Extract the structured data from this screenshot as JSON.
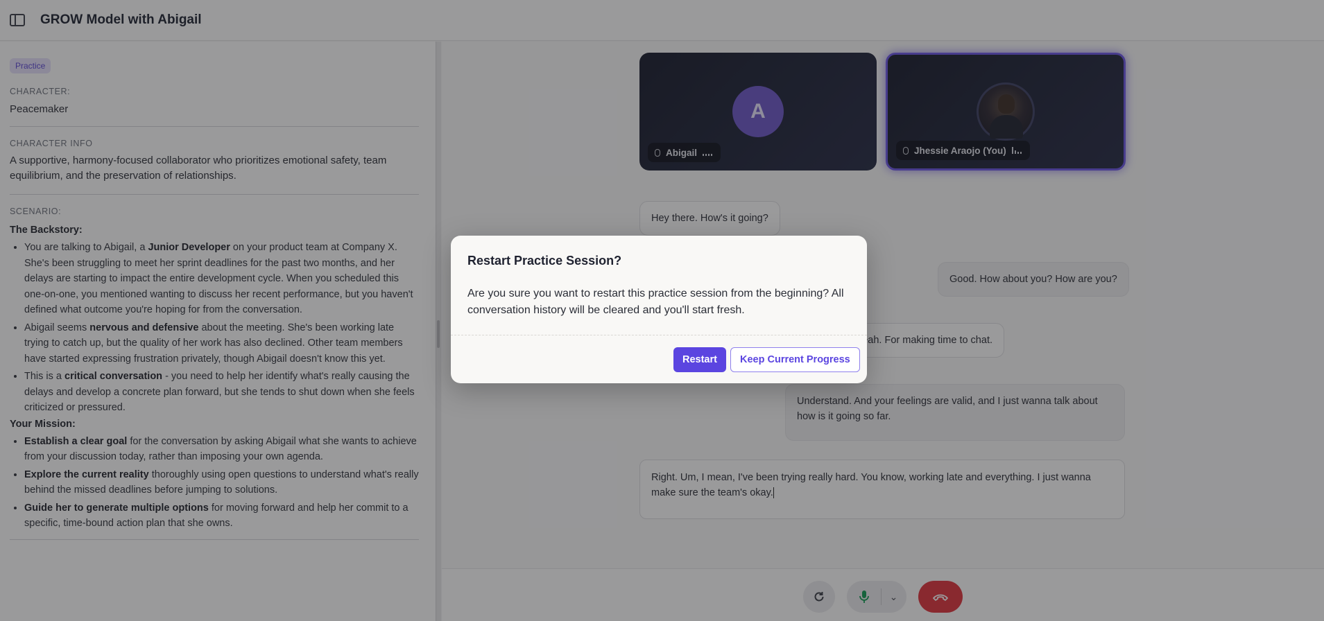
{
  "header": {
    "title": "GROW Model with Abigail",
    "toggle_icon": "sidebar-toggle-icon"
  },
  "left": {
    "badge": "Practice",
    "character_label": "CHARACTER:",
    "character_value": "Peacemaker",
    "info_label": "CHARACTER INFO",
    "info_value": "A supportive, harmony-focused collaborator who prioritizes emotional safety, team equilibrium, and the preservation of relationships.",
    "scenario_label": "SCENARIO:",
    "backstory_head": "The Backstory:",
    "backstory": [
      {
        "pre": "You are talking to Abigail, a ",
        "bold": "Junior Developer",
        "post": " on your product team at Company X. She's been struggling to meet her sprint deadlines for the past two months, and her delays are starting to impact the entire development cycle. When you scheduled this one-on-one, you mentioned wanting to discuss her recent performance, but you haven't defined what outcome you're hoping for from the conversation."
      },
      {
        "pre": "Abigail seems ",
        "bold": "nervous and defensive",
        "post": " about the meeting. She's been working late trying to catch up, but the quality of her work has also declined. Other team members have started expressing frustration privately, though Abigail doesn't know this yet."
      },
      {
        "pre": "This is a ",
        "bold": "critical conversation",
        "post": " - you need to help her identify what's really causing the delays and develop a concrete plan forward, but she tends to shut down when she feels criticized or pressured."
      }
    ],
    "mission_head": "Your Mission:",
    "mission": [
      {
        "pre": "",
        "bold": "Establish a clear goal",
        "post": " for the conversation by asking Abigail what she wants to achieve from your discussion today, rather than imposing your own agenda."
      },
      {
        "pre": "",
        "bold": "Explore the current reality",
        "post": " thoroughly using open questions to understand what's really behind the missed deadlines before jumping to solutions."
      },
      {
        "pre": "",
        "bold": "Guide her to generate multiple options",
        "post": " for moving forward and help her commit to a specific, time-bound action plan that she owns."
      }
    ]
  },
  "participants": {
    "ai": {
      "initial": "A",
      "name": "Abigail"
    },
    "user": {
      "name": "Jhessie Araojo (You)"
    }
  },
  "chat": {
    "m1": "Hey there. How's it going?",
    "m2": "Good. How about you? How are you?",
    "m3": "eah. For making time to chat.",
    "m4": " Understand. And your feelings are valid, and I just wanna talk about how is it going so far.",
    "input": " Right. Um, I mean, I've been trying really hard. You know, working late and everything. I just wanna make sure the team's okay."
  },
  "controls": {
    "refresh_icon": "refresh-icon",
    "mic_icon": "microphone-icon",
    "chevron_icon": "chevron-down-icon",
    "end_icon": "end-call-icon"
  },
  "modal": {
    "title": "Restart Practice Session?",
    "text": "Are you sure you want to restart this practice session from the beginning? All conversation history will be cleared and you'll start fresh.",
    "restart": "Restart",
    "keep": "Keep Current Progress"
  },
  "colors": {
    "accent": "#5b45e0",
    "end_call": "#e0323b",
    "mic_active": "#0f9b52"
  }
}
